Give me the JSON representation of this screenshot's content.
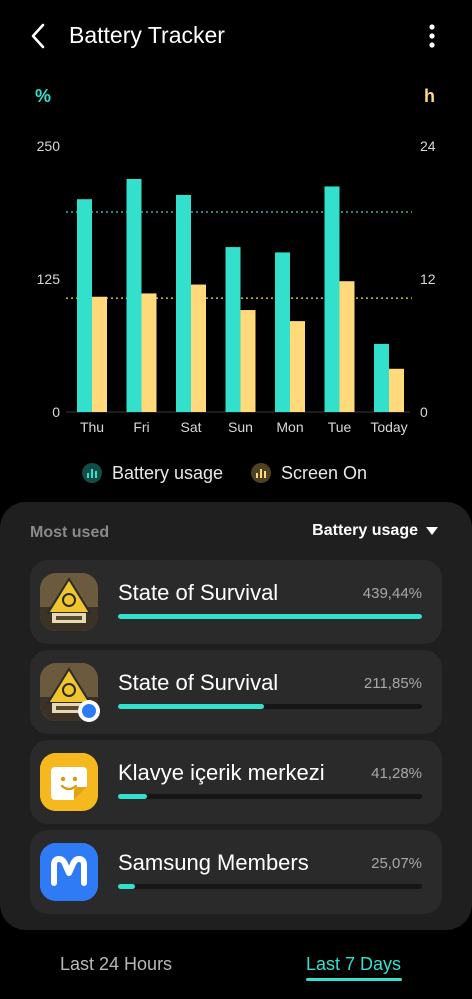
{
  "header": {
    "title": "Battery Tracker",
    "back_icon": "chevron-left-icon",
    "more_icon": "more-vert-icon"
  },
  "chart_data": {
    "type": "bar",
    "categories": [
      "Thu",
      "Fri",
      "Sat",
      "Sun",
      "Mon",
      "Tue",
      "Today"
    ],
    "series": [
      {
        "name": "Battery usage",
        "axis": "left",
        "color": "#33e0cc",
        "values": [
          200,
          219,
          204,
          155,
          150,
          212,
          64
        ]
      },
      {
        "name": "Screen On",
        "axis": "right",
        "color": "#ffd97a",
        "values": [
          10.4,
          10.7,
          11.5,
          9.2,
          8.2,
          11.8,
          3.9
        ]
      }
    ],
    "left_axis": {
      "label": "%",
      "ticks": [
        "250",
        "125",
        "0"
      ],
      "ylim": [
        0,
        250
      ]
    },
    "right_axis": {
      "label": "h",
      "ticks": [
        "24",
        "12",
        "0"
      ],
      "ylim": [
        0,
        24
      ]
    },
    "reference_lines": [
      {
        "axis": "left",
        "value": 188,
        "color": "#33e0cc"
      },
      {
        "axis": "left",
        "value": 107,
        "color": "#ffd97a"
      }
    ],
    "grid": false,
    "legend": "bottom"
  },
  "panel": {
    "most_used_label": "Most used",
    "sort_label": "Battery usage",
    "caret_icon": "caret-down-icon"
  },
  "apps": [
    {
      "name": "State of Survival",
      "percent": "439,44%",
      "fraction": 1.0,
      "icon": "state-of-survival-icon",
      "badge": false
    },
    {
      "name": "State of Survival",
      "percent": "211,85%",
      "fraction": 0.48,
      "icon": "state-of-survival-icon",
      "badge": true
    },
    {
      "name": "Klavye içerik merkezi",
      "percent": "41,28%",
      "fraction": 0.094,
      "icon": "keyboard-sticker-icon",
      "badge": false
    },
    {
      "name": "Samsung Members",
      "percent": "25,07%",
      "fraction": 0.057,
      "icon": "samsung-members-icon",
      "badge": false
    }
  ],
  "tabs": [
    {
      "label": "Last 24 Hours",
      "active": false
    },
    {
      "label": "Last 7 Days",
      "active": true
    }
  ],
  "colors": {
    "accent": "#33e0cc",
    "screen_on": "#ffd97a",
    "panel_bg": "#1f1f1f",
    "card_bg": "#2a2a2a"
  }
}
